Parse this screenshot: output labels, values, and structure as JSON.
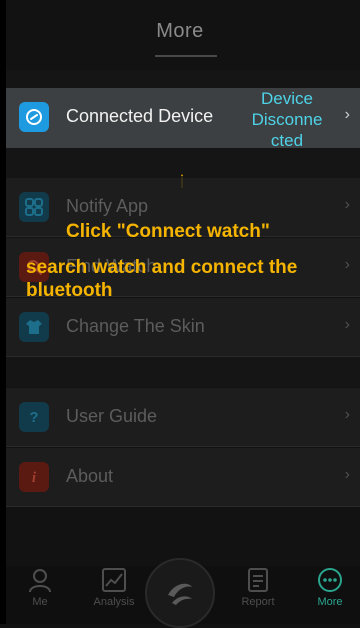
{
  "header": {
    "title": "More"
  },
  "menu": {
    "connected": {
      "label": "Connected Device",
      "status": "Device Disconnected",
      "status_lines": [
        "Device",
        "Disconne",
        "cted"
      ]
    },
    "notify": {
      "label": "Notify App"
    },
    "find": {
      "label": "Find Watch"
    },
    "skin": {
      "label": "Change The Skin"
    },
    "guide": {
      "label": "User Guide"
    },
    "about": {
      "label": "About"
    }
  },
  "instructions": {
    "line1": "Click \"Connect watch\"",
    "line2": "search watch and connect the bluetooth"
  },
  "tabbar": {
    "me": "Me",
    "analysis": "Analysis",
    "report": "Report",
    "more": "More"
  },
  "colors": {
    "accent": "#2aa58e",
    "status": "#4fd3e8",
    "instruction": "#f5b400",
    "connected_icon": "#1e9be0"
  }
}
